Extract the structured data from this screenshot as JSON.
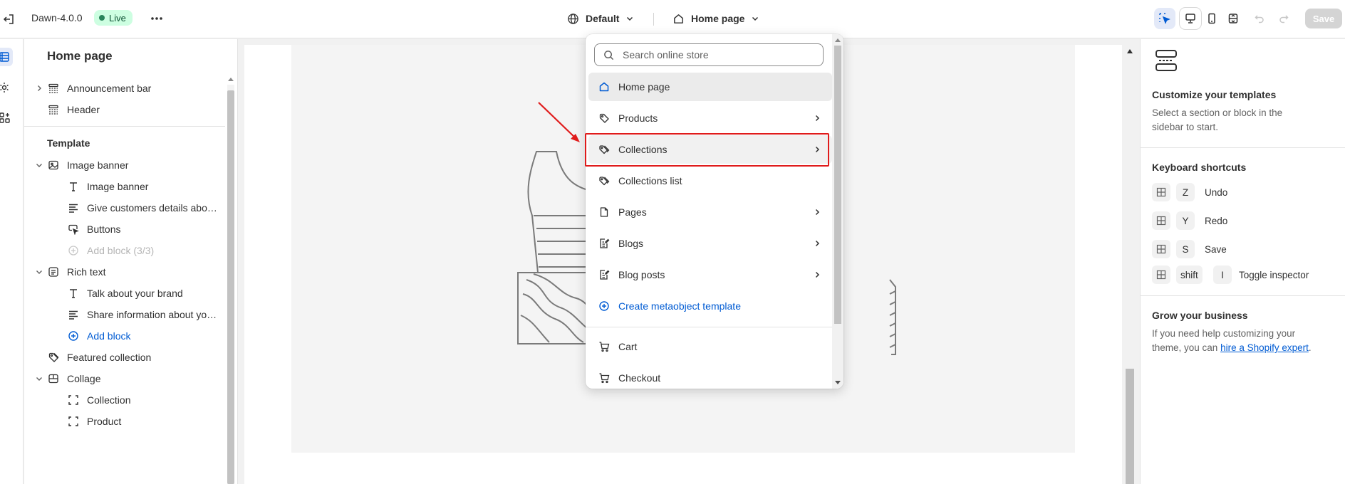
{
  "topbar": {
    "theme_name": "Dawn-4.0.0",
    "status_badge": "Live",
    "environment": "Default",
    "page": "Home page",
    "save_label": "Save"
  },
  "sidebar": {
    "title": "Home page",
    "header_items": [
      {
        "label": "Announcement bar",
        "icon": "layout-section-icon",
        "expandable": true
      },
      {
        "label": "Header",
        "icon": "layout-section-icon",
        "expandable": false
      }
    ],
    "template_label": "Template",
    "sections": [
      {
        "label": "Image banner",
        "icon": "image-banner-icon",
        "blocks": [
          {
            "label": "Image banner",
            "icon": "text-icon"
          },
          {
            "label": "Give customers details about the banner image(s) or content on the template.",
            "icon": "paragraph-icon"
          },
          {
            "label": "Buttons",
            "icon": "button-cursor-icon"
          },
          {
            "label": "Add block (3/3)",
            "icon": "add-circle-icon",
            "disabled": true
          }
        ]
      },
      {
        "label": "Rich text",
        "icon": "rich-text-icon",
        "blocks": [
          {
            "label": "Talk about your brand",
            "icon": "text-icon"
          },
          {
            "label": "Share information about your brand with your customers.",
            "icon": "paragraph-icon"
          },
          {
            "label": "Add block",
            "icon": "add-circle-icon",
            "link": true
          }
        ]
      },
      {
        "label": "Featured collection",
        "icon": "tag-icon",
        "blocks": []
      },
      {
        "label": "Collage",
        "icon": "collage-icon",
        "blocks": [
          {
            "label": "Collection",
            "icon": "frame-icon"
          },
          {
            "label": "Product",
            "icon": "frame-icon"
          }
        ]
      }
    ]
  },
  "dropdown": {
    "search_placeholder": "Search online store",
    "items": [
      {
        "label": "Home page",
        "icon": "home-icon",
        "has_submenu": false,
        "state": "selected"
      },
      {
        "label": "Products",
        "icon": "tag-icon",
        "has_submenu": true
      },
      {
        "label": "Collections",
        "icon": "collection-tag-icon",
        "has_submenu": true,
        "state": "hover"
      },
      {
        "label": "Collections list",
        "icon": "collection-tag-icon",
        "has_submenu": false
      },
      {
        "label": "Pages",
        "icon": "page-icon",
        "has_submenu": true
      },
      {
        "label": "Blogs",
        "icon": "blog-icon",
        "has_submenu": true
      },
      {
        "label": "Blog posts",
        "icon": "blog-icon",
        "has_submenu": true
      },
      {
        "label": "Create metaobject template",
        "icon": "add-circle-icon",
        "has_submenu": false,
        "link": true
      }
    ],
    "bottom_items": [
      {
        "label": "Cart",
        "icon": "cart-icon"
      },
      {
        "label": "Checkout",
        "icon": "cart-icon"
      }
    ]
  },
  "right_panel": {
    "heading": "Customize your templates",
    "description": "Select a section or block in the sidebar to start.",
    "shortcuts_heading": "Keyboard shortcuts",
    "shortcuts": [
      {
        "keys": [
          "Z"
        ],
        "label": "Undo"
      },
      {
        "keys": [
          "Y"
        ],
        "label": "Redo"
      },
      {
        "keys": [
          "S"
        ],
        "label": "Save"
      },
      {
        "keys": [
          "shift",
          "I"
        ],
        "label": "Toggle inspector"
      }
    ],
    "grow_heading": "Grow your business",
    "grow_text_before": "If you need help customizing your theme, you can ",
    "grow_link": "hire a Shopify expert",
    "grow_text_after": "."
  },
  "colors": {
    "accent": "#005bd3",
    "live_badge_bg": "#cdfee1",
    "annotation_red": "#e01b1b"
  }
}
